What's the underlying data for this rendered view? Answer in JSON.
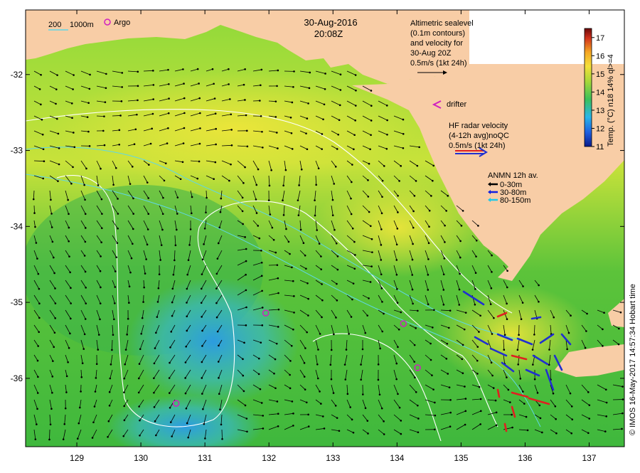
{
  "map": {
    "date": "30-Aug-2016",
    "time": "20:08Z",
    "longitude_ticks": [
      "129",
      "130",
      "131",
      "132",
      "133",
      "134",
      "135",
      "136",
      "137"
    ],
    "latitude_ticks": [
      "-32",
      "-33",
      "-34",
      "-35",
      "-36"
    ],
    "lon_range": [
      128.2,
      137.55
    ],
    "lat_range": [
      -31.15,
      -36.9
    ],
    "colors": {
      "land": "#f8cda6",
      "ocean_green": "#4cbf3a",
      "ocean_yellow": "#d9e63a",
      "ocean_blue": "#2f9ce8",
      "arrow": "#000000",
      "contour_white": "#ffffff",
      "contour_cyan": "#5fd7e6",
      "argo_marker": "#d020c0",
      "radar_red": "#e02020",
      "radar_blue": "#2030d0"
    }
  },
  "legend": {
    "isobath_200": "200",
    "isobath_1000": "1000m",
    "argo_label": "Argo",
    "altimetry_lines": [
      "Altimetric sealevel",
      "(0.1m contours)",
      "and velocity for",
      "30-Aug 20Z",
      "0.5m/s (1kt 24h)"
    ],
    "drifter_label": "drifter",
    "radar_lines": [
      "HF radar velocity",
      "(4-12h avg)noQC",
      "0.5m/s (1kt 24h)"
    ],
    "anmn_title": "ANMN 12h av.",
    "anmn_items": [
      {
        "label": "0-30m",
        "color": "#000000"
      },
      {
        "label": "30-80m",
        "color": "#1020e0"
      },
      {
        "label": "80-150m",
        "color": "#20c8e8"
      }
    ]
  },
  "colorbar": {
    "label": "Temp. (°C) n18 14% ql>=4",
    "ticks": [
      "17",
      "16",
      "15",
      "14",
      "13",
      "12",
      "11"
    ],
    "min": 11,
    "max": 17.5
  },
  "argo_floats": [
    {
      "lon": 131.95,
      "lat": -35.14
    },
    {
      "lon": 134.1,
      "lat": -35.28
    },
    {
      "lon": 134.32,
      "lat": -35.86
    },
    {
      "lon": 130.55,
      "lat": -36.33
    }
  ],
  "credit": "© IMOS 16-May-2017 14:57:34 Hobart time"
}
